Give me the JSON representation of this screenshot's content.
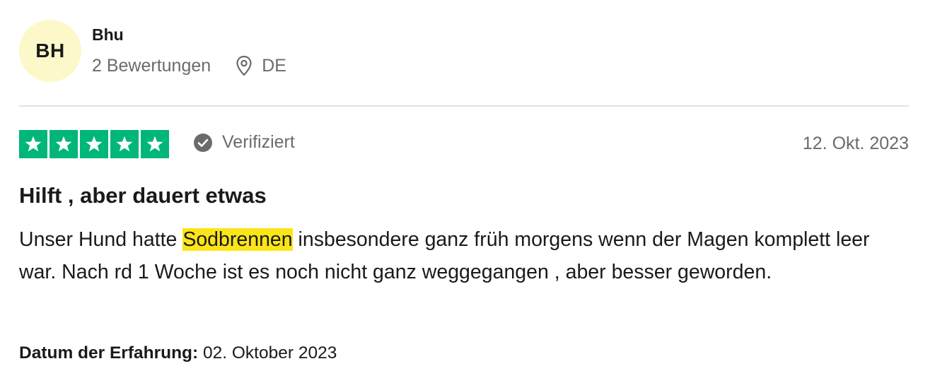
{
  "reviewer": {
    "initials": "BH",
    "name": "Bhu",
    "review_count": "2 Bewertungen",
    "country": "DE",
    "avatar_color": "#fdf8c9"
  },
  "rating": {
    "stars": 5,
    "max_stars": 5,
    "star_color": "#00b67a",
    "verified_label": "Verifiziert",
    "date": "12. Okt. 2023"
  },
  "review": {
    "title": "Hilft , aber dauert etwas",
    "body_before": "Unser Hund hatte ",
    "body_highlight": "Sodbrennen",
    "body_after": " insbesondere ganz früh morgens wenn der Magen komplett leer war. Nach rd 1 Woche ist es noch nicht ganz weggegangen , aber besser geworden.",
    "highlight_color": "#fbe517"
  },
  "experience": {
    "label": "Datum der Erfahrung:",
    "date": "02. Oktober 2023"
  },
  "icons": {
    "location": "location-pin-icon",
    "verified": "check-circle-icon",
    "star": "star-icon"
  }
}
